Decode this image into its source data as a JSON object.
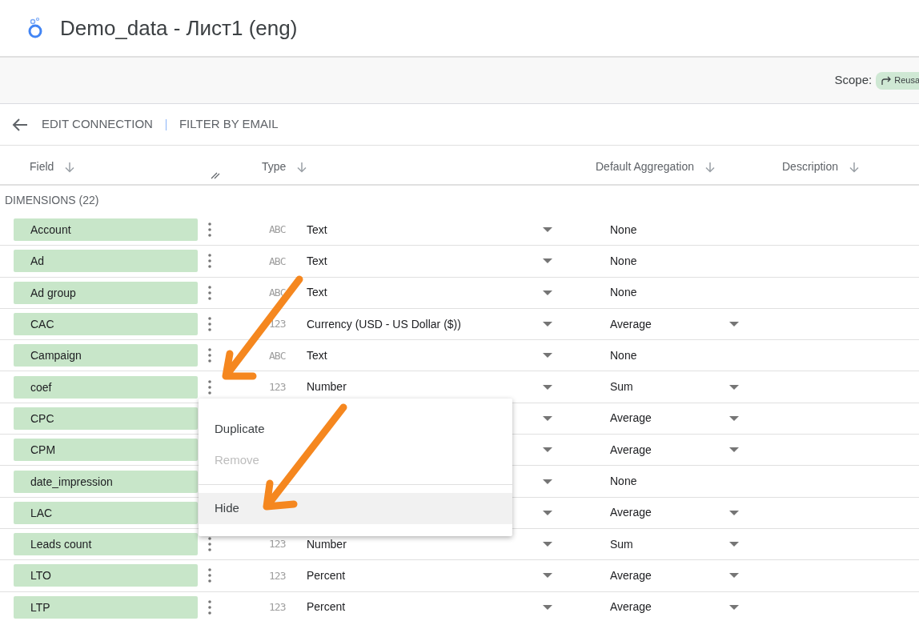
{
  "header": {
    "title": "Demo_data - Лист1 (eng)"
  },
  "scope_bar": {
    "label": "Scope:",
    "chip": "Reusa"
  },
  "toolbar": {
    "items": [
      "EDIT CONNECTION",
      "FILTER BY EMAIL"
    ]
  },
  "table": {
    "columns": [
      "Field",
      "Type",
      "Default Aggregation",
      "Description"
    ],
    "section": "DIMENSIONS (22)",
    "rows": [
      {
        "field": "Account",
        "type_icon": "ABC",
        "type": "Text",
        "aggregation": "None",
        "agg_editable": false
      },
      {
        "field": "Ad",
        "type_icon": "ABC",
        "type": "Text",
        "aggregation": "None",
        "agg_editable": false
      },
      {
        "field": "Ad group",
        "type_icon": "ABC",
        "type": "Text",
        "aggregation": "None",
        "agg_editable": false
      },
      {
        "field": "CAC",
        "type_icon": "123",
        "type": "Currency (USD - US Dollar ($))",
        "aggregation": "Average",
        "agg_editable": true
      },
      {
        "field": "Campaign",
        "type_icon": "ABC",
        "type": "Text",
        "aggregation": "None",
        "agg_editable": false
      },
      {
        "field": "coef",
        "type_icon": "123",
        "type": "Number",
        "aggregation": "Sum",
        "agg_editable": true
      },
      {
        "field": "CPC",
        "aggregation": "Average",
        "agg_editable": true
      },
      {
        "field": "CPM",
        "aggregation": "Average",
        "agg_editable": true
      },
      {
        "field": "date_impression",
        "aggregation": "None",
        "agg_editable": false
      },
      {
        "field": "LAC",
        "aggregation": "Average",
        "agg_editable": true
      },
      {
        "field": "Leads count",
        "type_icon": "123",
        "type": "Number",
        "aggregation": "Sum",
        "agg_editable": true
      },
      {
        "field": "LTO",
        "type_icon": "123",
        "type": "Percent",
        "aggregation": "Average",
        "agg_editable": true
      },
      {
        "field": "LTP",
        "type_icon": "123",
        "type": "Percent",
        "aggregation": "Average",
        "agg_editable": true
      }
    ]
  },
  "context_menu": {
    "items": [
      {
        "label": "Duplicate",
        "disabled": false,
        "selected": false
      },
      {
        "label": "Remove",
        "disabled": true,
        "selected": false
      },
      {
        "label": "Hide",
        "disabled": false,
        "selected": true
      }
    ]
  }
}
